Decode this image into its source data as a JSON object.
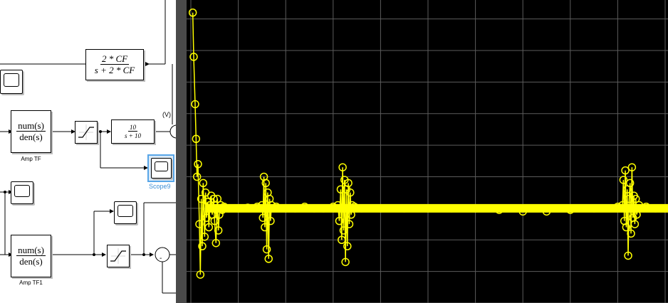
{
  "diagram": {
    "feedback_tf": {
      "num": "2 * CF",
      "den": "s + 2 * CF"
    },
    "amp_tf": {
      "num": "num(s)",
      "den": "den(s)",
      "caption": "Amp TF"
    },
    "amp_tf1": {
      "num": "num(s)",
      "den": "den(s)",
      "caption": "Amp TF1"
    },
    "filter_tf": {
      "num": "10",
      "den": "s + 10"
    },
    "signal_label": "(V)",
    "sum_sign": "-",
    "scope9_caption": "Scope9"
  },
  "chart_data": {
    "type": "line",
    "marker": "circle",
    "title": "",
    "xlabel": "",
    "ylabel": "",
    "ylim": [
      -3,
      6.6
    ],
    "xlim": [
      0,
      1
    ],
    "yticks": [
      "6",
      "5",
      "4",
      "3",
      "2",
      "1",
      "0",
      "-1",
      "-2",
      "-3"
    ],
    "ytick_values": [
      6,
      5,
      4,
      3,
      2,
      1,
      0,
      -1,
      -2,
      -3
    ],
    "grid": true,
    "colors": {
      "background": "#000000",
      "grid": "#5c5c5c",
      "trace": "#ffff00",
      "tick_text": "#c8c8c8"
    },
    "series": [
      {
        "color": "#ffff00",
        "x": [
          0.004,
          0.006,
          0.009,
          0.011,
          0.013,
          0.015,
          0.018,
          0.02,
          0.022,
          0.024,
          0.026,
          0.029,
          0.031,
          0.033,
          0.036,
          0.038,
          0.04,
          0.043,
          0.045,
          0.048,
          0.05,
          0.053,
          0.056,
          0.058,
          0.06,
          0.063,
          0.066,
          0.07,
          0.08,
          0.1,
          0.12,
          0.14,
          0.15,
          0.152,
          0.154,
          0.156,
          0.158,
          0.16,
          0.162,
          0.164,
          0.166,
          0.168,
          0.17,
          0.18,
          0.2,
          0.22,
          0.24,
          0.26,
          0.28,
          0.3,
          0.31,
          0.313,
          0.316,
          0.318,
          0.32,
          0.322,
          0.324,
          0.326,
          0.328,
          0.33,
          0.332,
          0.334,
          0.336,
          0.338,
          0.34,
          0.345,
          0.36,
          0.4,
          0.45,
          0.5,
          0.55,
          0.6,
          0.65,
          0.7,
          0.75,
          0.8,
          0.85,
          0.9,
          0.91,
          0.912,
          0.914,
          0.916,
          0.918,
          0.92,
          0.922,
          0.924,
          0.926,
          0.928,
          0.93,
          0.932,
          0.934,
          0.936,
          0.938,
          0.94,
          0.945,
          0.96,
          0.98,
          1.0
        ],
        "y": [
          6.2,
          4.8,
          3.3,
          2.2,
          1.0,
          1.4,
          -0.5,
          -2.1,
          0.3,
          -1.2,
          0.8,
          -0.9,
          0.5,
          -0.3,
          0.2,
          -0.6,
          0.1,
          0.4,
          -0.2,
          0.3,
          -0.4,
          -1.1,
          0.3,
          -0.7,
          -0.2,
          0.1,
          -0.05,
          0.05,
          0.0,
          0.0,
          0.02,
          0.05,
          0.1,
          -0.3,
          1.0,
          -0.6,
          0.8,
          -1.3,
          0.5,
          -1.6,
          0.3,
          -0.4,
          0.1,
          0.05,
          0.0,
          0.0,
          0.05,
          0.0,
          0.0,
          0.05,
          0.1,
          -0.4,
          0.6,
          -1.0,
          1.3,
          -0.7,
          0.9,
          -1.7,
          0.6,
          -1.2,
          0.8,
          -0.5,
          0.5,
          -0.2,
          0.1,
          0.05,
          0.0,
          0.0,
          0.0,
          0.0,
          0.0,
          0.0,
          -0.05,
          -0.1,
          -0.1,
          -0.05,
          0.0,
          0.05,
          0.1,
          0.9,
          -0.4,
          1.2,
          -0.6,
          0.6,
          -1.5,
          0.3,
          0.8,
          -0.8,
          1.3,
          -0.3,
          0.4,
          -0.5,
          0.3,
          -0.2,
          0.1,
          0.05,
          0.0,
          0.0
        ]
      }
    ]
  }
}
